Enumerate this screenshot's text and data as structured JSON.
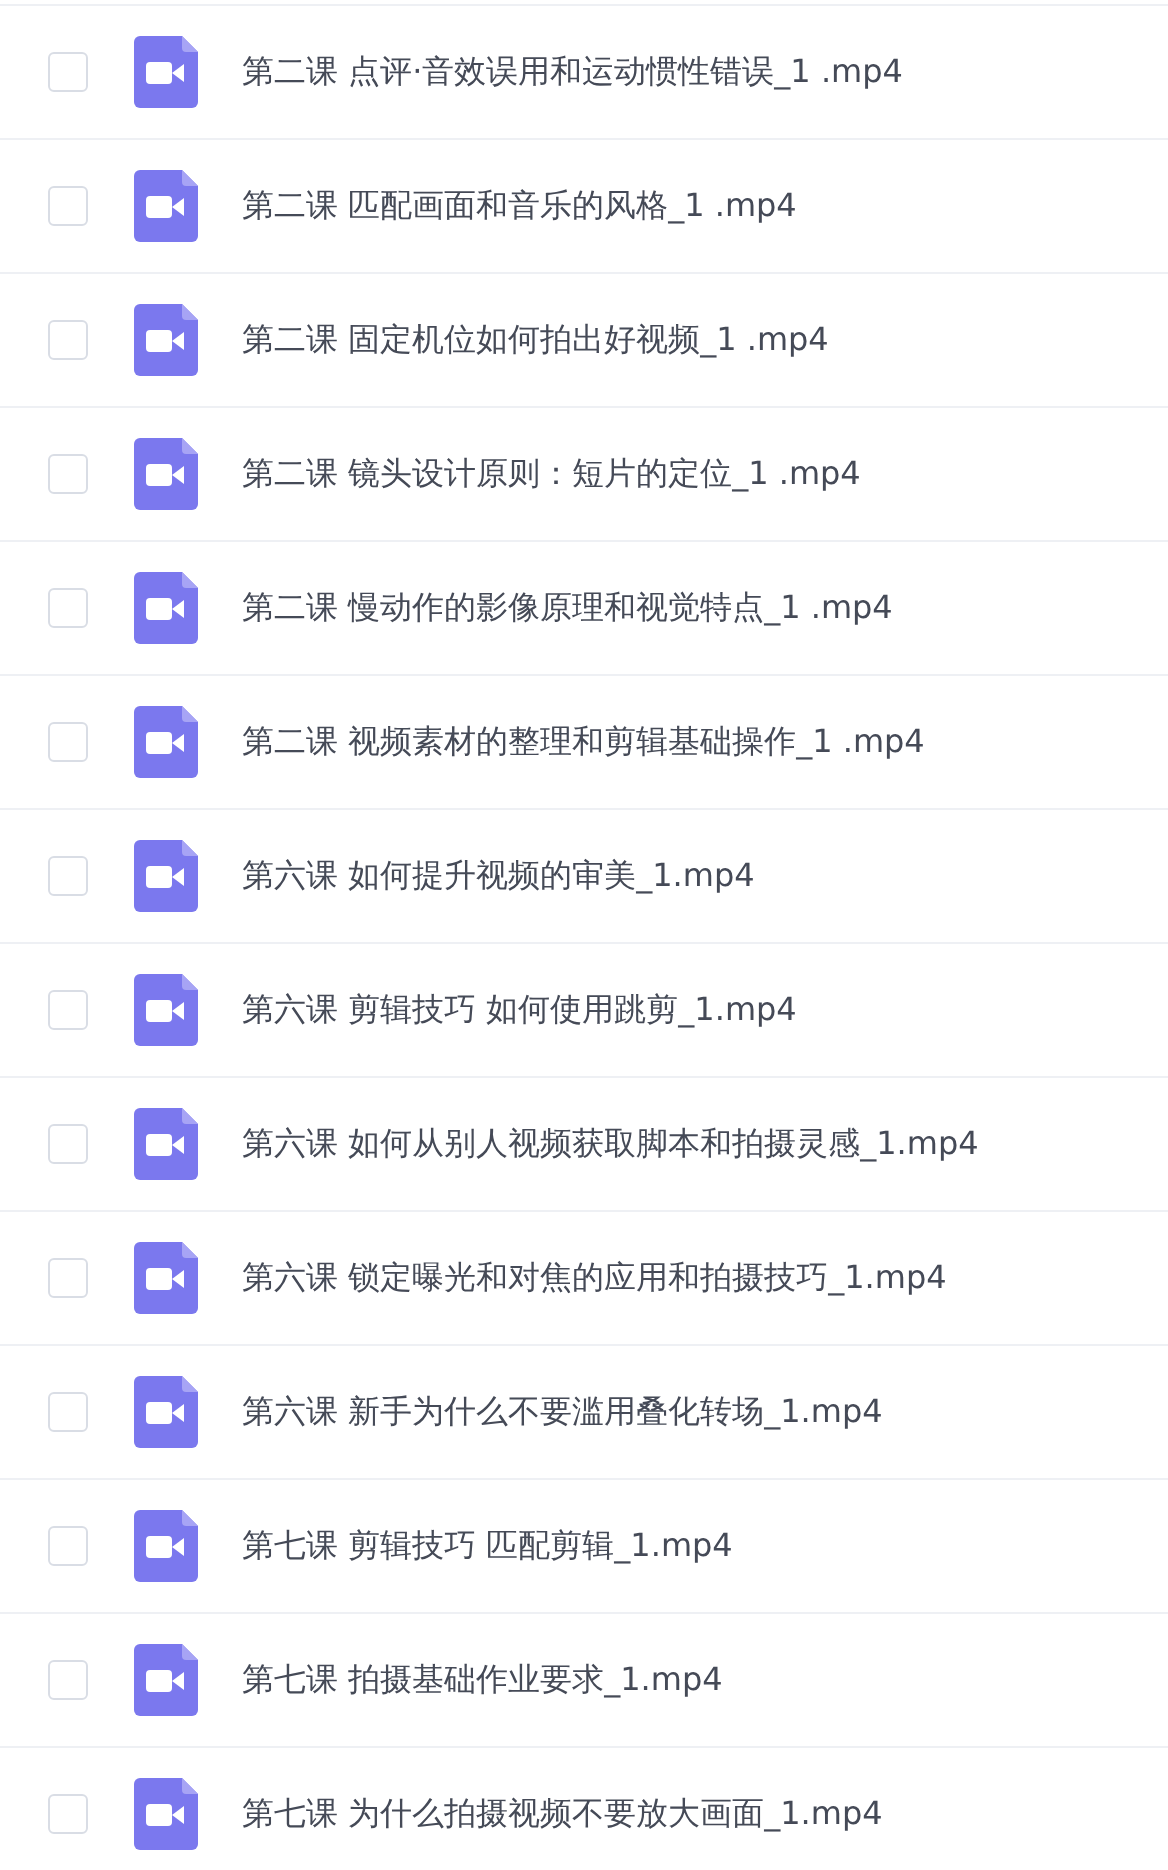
{
  "files": [
    {
      "name": "第二课 点评·音效误用和运动惯性错误_1 .mp4",
      "checked": false
    },
    {
      "name": "第二课 匹配画面和音乐的风格_1 .mp4",
      "checked": false
    },
    {
      "name": "第二课 固定机位如何拍出好视频_1 .mp4",
      "checked": false
    },
    {
      "name": "第二课 镜头设计原则：短片的定位_1 .mp4",
      "checked": false
    },
    {
      "name": "第二课 慢动作的影像原理和视觉特点_1 .mp4",
      "checked": false
    },
    {
      "name": "第二课 视频素材的整理和剪辑基础操作_1 .mp4",
      "checked": false
    },
    {
      "name": "第六课 如何提升视频的审美_1.mp4",
      "checked": false
    },
    {
      "name": "第六课 剪辑技巧 如何使用跳剪_1.mp4",
      "checked": false
    },
    {
      "name": "第六课 如何从别人视频获取脚本和拍摄灵感_1.mp4",
      "checked": false
    },
    {
      "name": "第六课 锁定曝光和对焦的应用和拍摄技巧_1.mp4",
      "checked": false
    },
    {
      "name": "第六课 新手为什么不要滥用叠化转场_1.mp4",
      "checked": false
    },
    {
      "name": "第七课 剪辑技巧 匹配剪辑_1.mp4",
      "checked": false
    },
    {
      "name": "第七课 拍摄基础作业要求_1.mp4",
      "checked": false
    },
    {
      "name": "第七课 为什么拍摄视频不要放大画面_1.mp4",
      "checked": false
    }
  ]
}
